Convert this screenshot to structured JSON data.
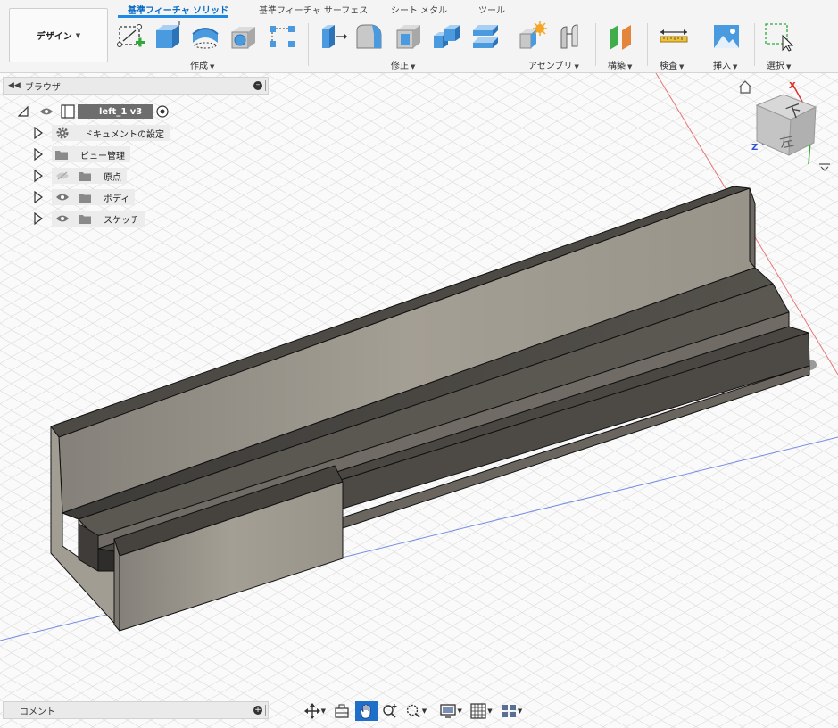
{
  "workspace": {
    "label": "デザイン"
  },
  "tabs": [
    {
      "label": "基準フィーチャ ソリッド",
      "active": true
    },
    {
      "label": "基準フィーチャ サーフェス",
      "active": false
    },
    {
      "label": "シート メタル",
      "active": false
    },
    {
      "label": "ツール",
      "active": false
    }
  ],
  "toolbar": {
    "groups": [
      {
        "label": "作成",
        "tools": [
          "create-sketch-icon",
          "extrude-icon",
          "revolve-icon",
          "hole-icon",
          "pattern-icon"
        ]
      },
      {
        "label": "修正",
        "tools": [
          "press-pull-icon",
          "fillet-icon",
          "shell-icon",
          "combine-icon",
          "move-copy-icon"
        ]
      },
      {
        "label": "アセンブリ",
        "tools": [
          "new-component-icon",
          "joint-icon"
        ]
      },
      {
        "label": "構築",
        "tools": [
          "offset-plane-icon"
        ]
      },
      {
        "label": "検査",
        "tools": [
          "measure-icon"
        ]
      },
      {
        "label": "挿入",
        "tools": [
          "insert-image-icon"
        ]
      },
      {
        "label": "選択",
        "tools": [
          "select-icon"
        ]
      }
    ]
  },
  "browser": {
    "title": "ブラウザ",
    "root": {
      "label": "left_1 v3"
    },
    "items": [
      {
        "label": "ドキュメントの設定",
        "icon": "gear-icon"
      },
      {
        "label": "ビュー管理",
        "icon": "folder-icon"
      },
      {
        "label": "原点",
        "icon": "folder-icon",
        "eye": "hidden"
      },
      {
        "label": "ボディ",
        "icon": "folder-icon",
        "eye": "visible"
      },
      {
        "label": "スケッチ",
        "icon": "folder-icon",
        "eye": "visible"
      }
    ]
  },
  "viewcube": {
    "face_top": "下",
    "face_front": "左",
    "axis_x": "X",
    "axis_z": "Z"
  },
  "comments": {
    "label": "コメント"
  },
  "colors": {
    "accent": "#1d8ae6",
    "body_light": "#9b968b",
    "body_dark": "#4b4843",
    "axis_x": "#e0302c",
    "axis_z": "#2f55d6"
  }
}
